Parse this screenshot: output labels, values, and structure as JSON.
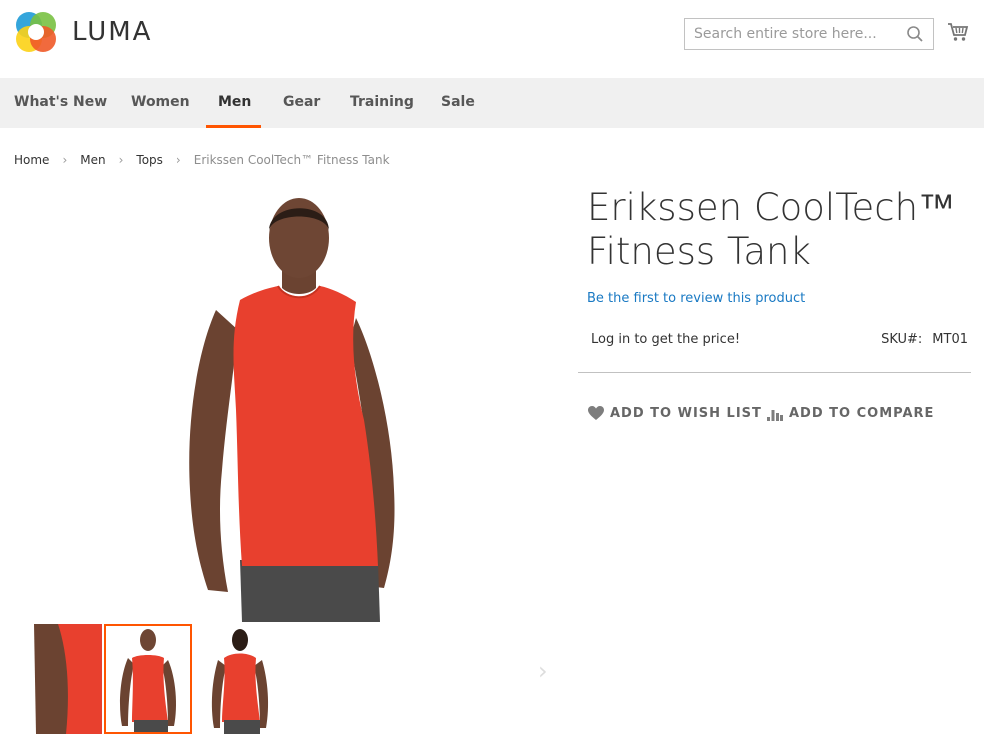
{
  "header": {
    "logo_text": "LUMA",
    "search_placeholder": "Search entire store here..."
  },
  "nav": {
    "items": [
      "What's New",
      "Women",
      "Men",
      "Gear",
      "Training",
      "Sale"
    ],
    "active": "Men"
  },
  "breadcrumb": {
    "items": [
      "Home",
      "Men",
      "Tops",
      "Erikssen CoolTech™ Fitness Tank"
    ]
  },
  "product": {
    "title": "Erikssen CoolTech™ Fitness Tank",
    "review_link": "Be the first to review this product",
    "price_message": "Log in to get the price!",
    "sku_label": "SKU#:",
    "sku_value": "MT01",
    "actions": {
      "wishlist": "ADD TO WISH LIST",
      "compare": "ADD TO COMPARE"
    }
  },
  "gallery": {
    "thumbnails": 3,
    "selected_index": 1
  },
  "colors": {
    "accent": "#ff5501",
    "link": "#1979c3",
    "nav_bg": "#f0f0f0",
    "tank_red": "#e8402e"
  }
}
